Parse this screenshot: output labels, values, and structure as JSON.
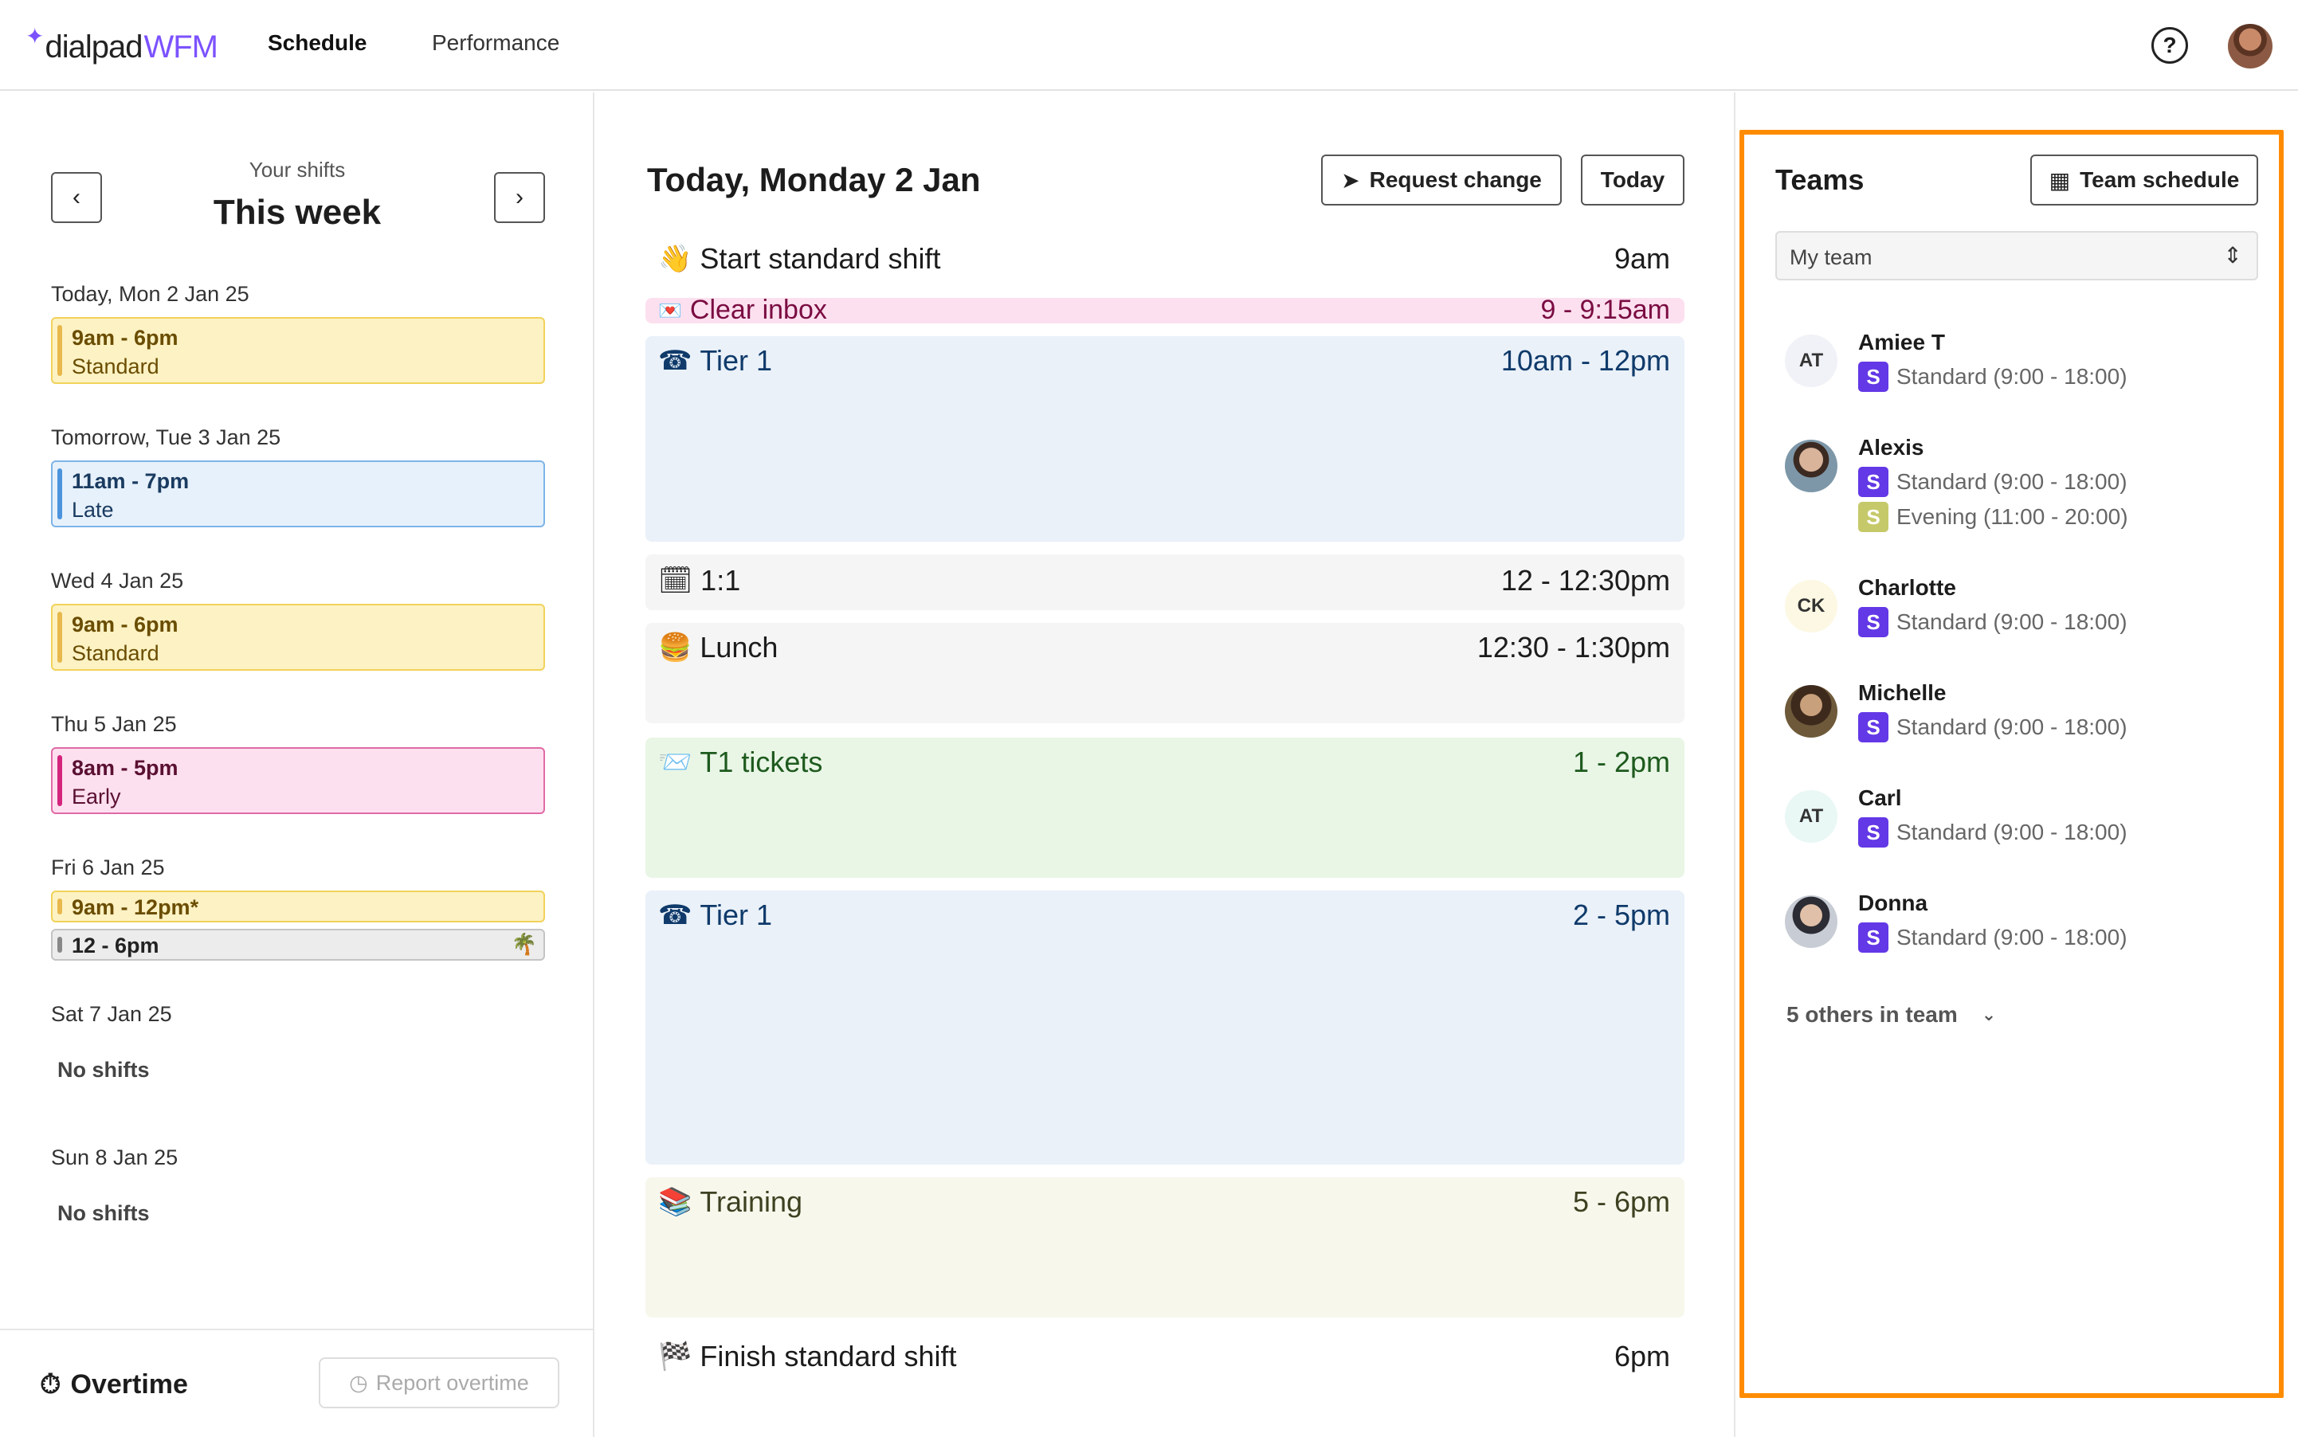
{
  "header": {
    "logo_name": "dialpad",
    "logo_wfm": "WFM",
    "nav": [
      "Schedule",
      "Performance"
    ],
    "help": "?"
  },
  "left": {
    "your_shifts": "Your shifts",
    "this_week": "This week",
    "days": [
      {
        "label": "Today, Mon 2 Jan 25",
        "shifts": [
          {
            "time": "9am - 6pm",
            "type": "Standard",
            "color": "#fdf2c4"
          }
        ]
      },
      {
        "label": "Tomorrow, Tue 3 Jan 25",
        "shifts": [
          {
            "time": "11am - 7pm",
            "type": "Late",
            "color": "#e7f1fb"
          }
        ]
      },
      {
        "label": "Wed 4 Jan 25",
        "shifts": [
          {
            "time": "9am - 6pm",
            "type": "Standard",
            "color": "#fdf2c4"
          }
        ]
      },
      {
        "label": "Thu 5 Jan 25",
        "shifts": [
          {
            "time": "8am - 5pm",
            "type": "Early",
            "color": "#fde0ef"
          }
        ]
      },
      {
        "label": "Fri 6 Jan 25",
        "shifts": [
          {
            "time": "9am - 12pm*"
          },
          {
            "time": "12 - 6pm",
            "icon": "palm-tree-icon"
          }
        ]
      },
      {
        "label": "Sat 7 Jan 25",
        "no_shifts": "No shifts"
      },
      {
        "label": "Sun 8 Jan 25",
        "no_shifts": "No shifts"
      }
    ],
    "overtime": {
      "title": "Overtime",
      "report_label": "Report overtime"
    }
  },
  "middle": {
    "title": "Today, Monday 2 Jan",
    "request_change": "Request change",
    "today": "Today",
    "events": [
      {
        "icon": "waving-hand-icon",
        "emoji": "👋",
        "title": "Start standard shift",
        "time": "9am"
      },
      {
        "icon": "love-letter-icon",
        "emoji": "💌",
        "title": "Clear inbox",
        "time": "9 - 9:15am"
      },
      {
        "icon": "telephone-icon",
        "emoji": "☎️",
        "title": "Tier 1",
        "time": "10am - 12pm"
      },
      {
        "icon": "calendar-icon",
        "emoji": "🗓️",
        "title": "1:1",
        "time": "12 - 12:30pm"
      },
      {
        "icon": "burger-icon",
        "emoji": "🍔",
        "title": "Lunch",
        "time": "12:30 - 1:30pm"
      },
      {
        "icon": "inbox-tray-icon",
        "emoji": "📨",
        "title": "T1 tickets",
        "time": "1 - 2pm"
      },
      {
        "icon": "telephone-icon",
        "emoji": "☎️",
        "title": "Tier 1",
        "time": "2 - 5pm"
      },
      {
        "icon": "books-icon",
        "emoji": "📚",
        "title": "Training",
        "time": "5 - 6pm"
      },
      {
        "icon": "checkered-flag-icon",
        "emoji": "🏁",
        "title": "Finish standard shift",
        "time": "6pm"
      }
    ]
  },
  "right": {
    "title": "Teams",
    "team_schedule": "Team schedule",
    "select_value": "My team",
    "members": [
      {
        "name": "Amiee T",
        "initials": "AT",
        "shifts": [
          {
            "badge": "S",
            "label": "Standard (9:00 - 18:00)"
          }
        ]
      },
      {
        "name": "Alexis",
        "initials": "",
        "shifts": [
          {
            "badge": "S",
            "label": "Standard (9:00 - 18:00)"
          },
          {
            "badge": "S",
            "label": "Evening (11:00 - 20:00)"
          }
        ]
      },
      {
        "name": "Charlotte",
        "initials": "CK",
        "shifts": [
          {
            "badge": "S",
            "label": "Standard (9:00 - 18:00)"
          }
        ]
      },
      {
        "name": "Michelle",
        "initials": "",
        "shifts": [
          {
            "badge": "S",
            "label": "Standard (9:00 - 18:00)"
          }
        ]
      },
      {
        "name": "Carl",
        "initials": "AT",
        "shifts": [
          {
            "badge": "S",
            "label": "Standard (9:00 - 18:00)"
          }
        ]
      },
      {
        "name": "Donna",
        "initials": "",
        "shifts": [
          {
            "badge": "S",
            "label": "Standard (9:00 - 18:00)"
          }
        ]
      }
    ],
    "others": "5 others in team"
  }
}
